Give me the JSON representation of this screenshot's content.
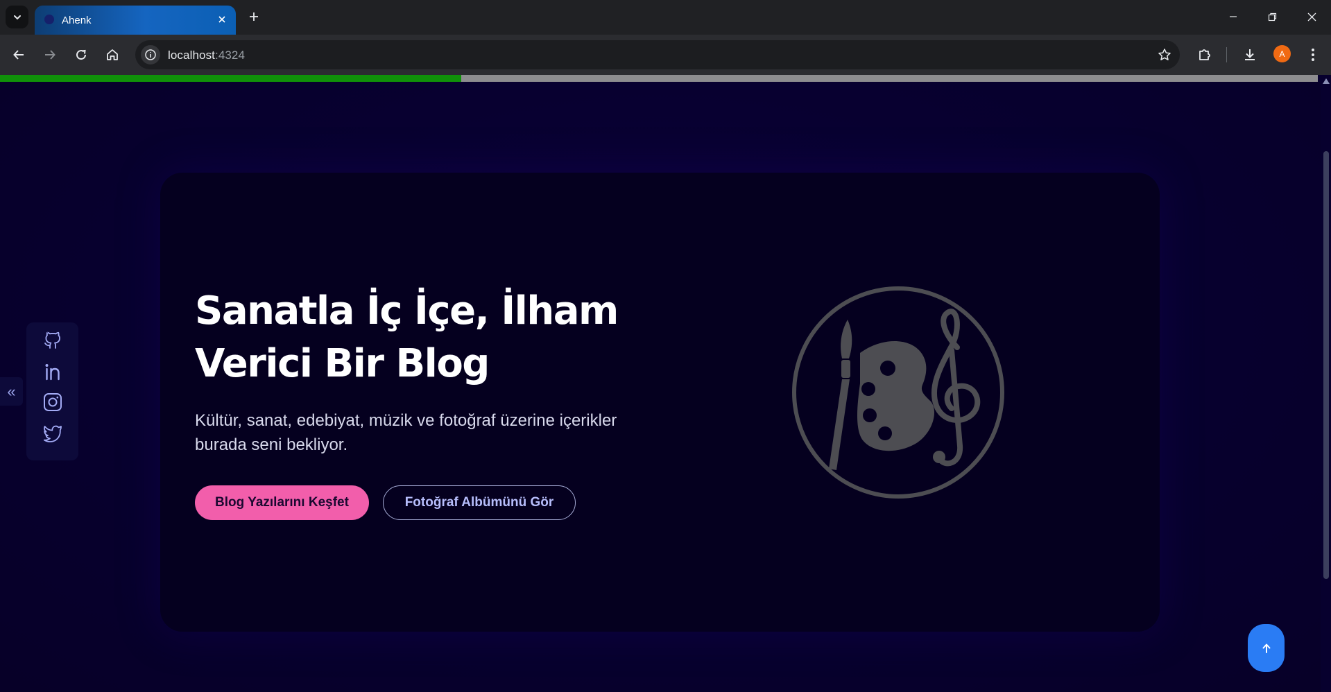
{
  "browser": {
    "tab_title": "Ahenk",
    "url_host": "localhost",
    "url_port": ":4324",
    "avatar_letter": "A",
    "page_load_progress": 0.35
  },
  "hero": {
    "title_line1": "Sanatla İç İçe, İlham",
    "title_line2": "Verici Bir Blog",
    "subtitle_line1": "Kültür, sanat, edebiyat, müzik ve fotoğraf üzerine içerikler",
    "subtitle_line2": "burada seni bekliyor.",
    "primary_button": "Blog Yazılarını Keşfet",
    "secondary_button": "Fotoğraf Albümünü Gör",
    "illustration_icon": "palette-treble-clef-icon"
  },
  "social": {
    "toggle_glyph": "«",
    "items": [
      "github-icon",
      "linkedin-icon",
      "instagram-icon",
      "twitter-icon"
    ]
  },
  "colors": {
    "page_bg": "#070030",
    "card_bg": "#05001f",
    "accent_pink": "#f25eab",
    "secondary_text": "#b7befc",
    "back_to_top": "#2a7cf4",
    "progress_green": "#109109"
  }
}
